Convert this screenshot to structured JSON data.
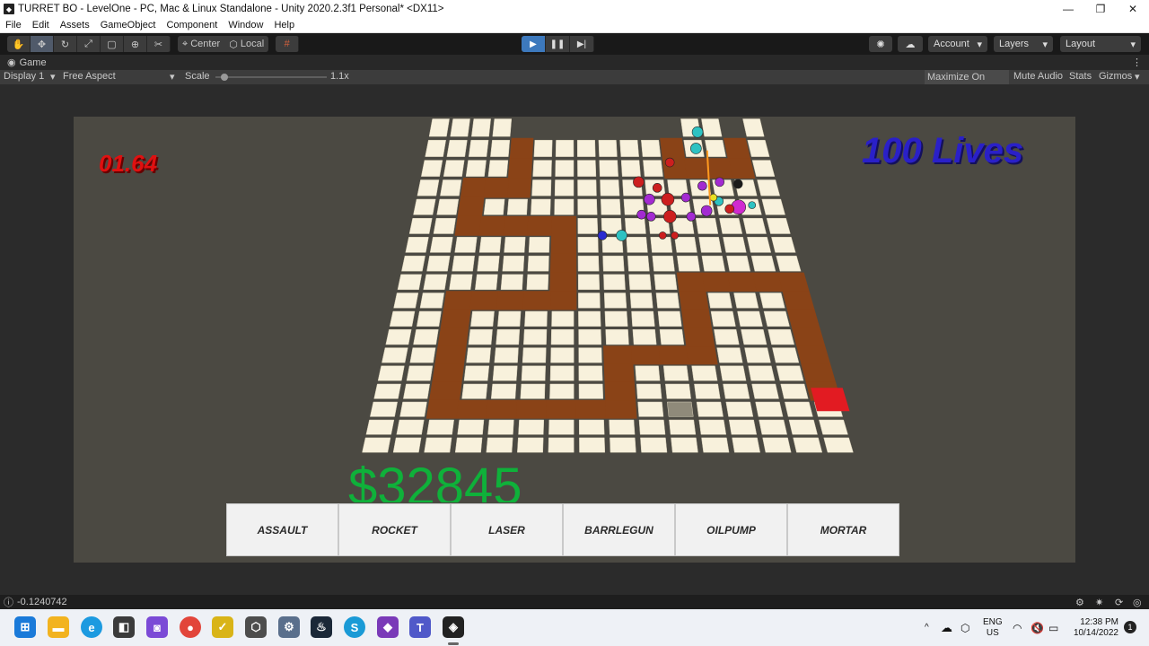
{
  "window": {
    "title": "TURRET BO - LevelOne - PC, Mac & Linux Standalone - Unity 2020.2.3f1 Personal* <DX11>"
  },
  "menu": [
    "File",
    "Edit",
    "Assets",
    "GameObject",
    "Component",
    "Window",
    "Help"
  ],
  "toolbar": {
    "center_label": "Center",
    "local_label": "Local",
    "account_label": "Account",
    "layers_label": "Layers",
    "layout_label": "Layout"
  },
  "game_view": {
    "tab_label": "Game",
    "display": "Display 1",
    "aspect": "Free Aspect",
    "scale_label": "Scale",
    "scale_value": "1.1x",
    "scale_level": 0.05,
    "maximize_label": "Maximize On Play",
    "mute_label": "Mute Audio",
    "stats_label": "Stats",
    "gizmos_label": "Gizmos"
  },
  "hud": {
    "timer": "01.64",
    "lives": "100 Lives",
    "money": "$32845"
  },
  "turrets": [
    "ASSAULT",
    "ROCKET",
    "LASER",
    "BARRLEGUN",
    "OILPUMP",
    "MORTAR"
  ],
  "status": {
    "message": "-0.1240742"
  },
  "taskbar": {
    "language": "ENG",
    "region": "US",
    "time": "12:38 PM",
    "date": "10/14/2022",
    "notification_count": "1"
  },
  "colors": {
    "path": "#8a4317",
    "tile": "#f8f1dc",
    "money": "#0fb13a",
    "lives": "#2a20c8",
    "timer": "#e01010",
    "base": "#e21b22"
  }
}
